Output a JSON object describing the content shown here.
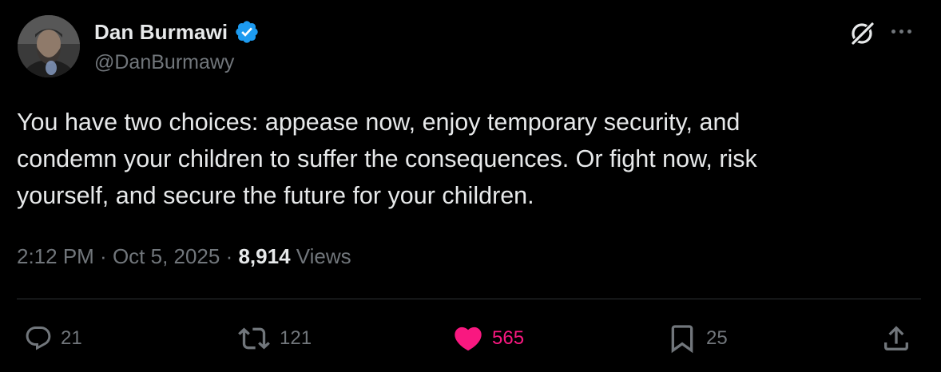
{
  "author": {
    "display_name": "Dan Burmawi",
    "handle": "@DanBurmawy",
    "verified": true,
    "verified_color": "#1d9bf0",
    "avatar_icon": "profile-photo"
  },
  "header_icons": {
    "grok": "grok-icon",
    "more": "more-icon"
  },
  "tweet": {
    "text": "You have two choices: appease now, enjoy temporary security, and\ncondemn your children to suffer the consequences. Or fight now, risk\nyourself, and secure the future for your children."
  },
  "meta": {
    "time": "2:12 PM",
    "separator": " · ",
    "date": "Oct 5, 2025",
    "views_count": "8,914",
    "views_label": " Views"
  },
  "actions": {
    "reply_count": "21",
    "retweet_count": "121",
    "like_count": "565",
    "bookmark_count": "25",
    "like_color": "#f91880",
    "icons": [
      "reply-icon",
      "retweet-icon",
      "heart-icon",
      "bookmark-icon",
      "share-icon"
    ]
  }
}
